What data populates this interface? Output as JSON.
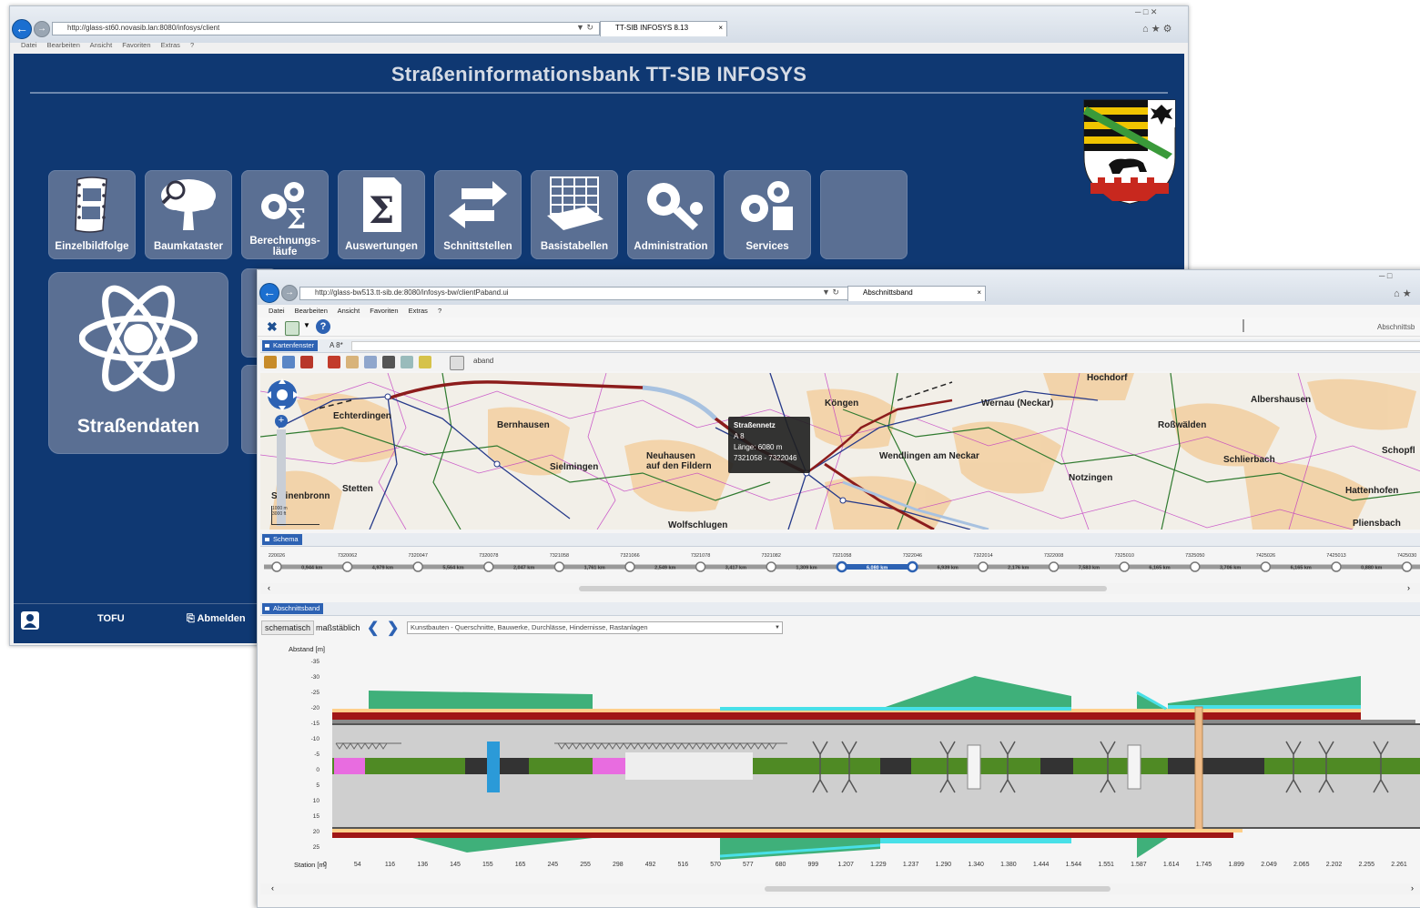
{
  "back_window": {
    "address": "http://glass-st60.novasib.lan:8080/infosys/client",
    "tab_title": "TT-SIB INFOSYS 8.13",
    "menu": [
      "Datei",
      "Bearbeiten",
      "Ansicht",
      "Favoriten",
      "Extras",
      "?"
    ],
    "portal": {
      "title": "Straßeninformationsbank TT-SIB INFOSYS",
      "tiles": [
        {
          "label": "Einzelbildfolge",
          "icon": "film-icon"
        },
        {
          "label": "Baumkataster",
          "icon": "tree-icon"
        },
        {
          "label": "Berechnungs-",
          "label2": "läufe",
          "icon": "gears-sigma-icon"
        },
        {
          "label": "Auswertungen",
          "icon": "sigma-icon"
        },
        {
          "label": "Schnittstellen",
          "icon": "arrows-exchange-icon"
        },
        {
          "label": "Basistabellen",
          "icon": "table-grid-icon"
        },
        {
          "label": "Administration",
          "icon": "gear-wrench-icon"
        },
        {
          "label": "Services",
          "icon": "gears-icon"
        }
      ],
      "big_tile": {
        "label": "Straßendaten",
        "icon": "atom-icon"
      },
      "footer": {
        "center": "TOFU",
        "logout": "Abmelden"
      }
    }
  },
  "front_window": {
    "address": "http://glass-bw513.tt-sib.de:8080/infosys-bw/clientPaband.ui",
    "tab_title": "Abschnittsband",
    "menu": [
      "Datei",
      "Bearbeiten",
      "Ansicht",
      "Favoriten",
      "Extras",
      "?"
    ],
    "right_label": "Abschnittsb",
    "map_panel": {
      "tab": "Kartenfenster",
      "road": "A 8*",
      "toolbar_text": "aband",
      "towns": [
        "Hochdorf",
        "Köngen",
        "Wernau (Neckar)",
        "Albershausen",
        "Echterdingen",
        "Bernhausen",
        "Roßwälden",
        "Schopfl",
        "Wendlingen am Neckar",
        "Neuhausen",
        "auf den Fildern",
        "Sielmingen",
        "Schlierbach",
        "Notzingen",
        "Hattenhofen",
        "Stetten",
        "Steinenbronn",
        "Wolfschlugen",
        "Pliensbach"
      ],
      "tooltip": {
        "line1": "Straßennetz",
        "line2": "A 8",
        "line3": "Länge: 6080 m",
        "line4": "7321058 - 7322046"
      },
      "scale_1": "1000 m",
      "scale_2": "3000 ft"
    },
    "schema_panel": {
      "tab": "Schema",
      "nodes": [
        "220026",
        "7320062",
        "7320047",
        "7320078",
        "7321058",
        "7321066",
        "7321078",
        "7321082",
        "7321058",
        "7322046",
        "7322014",
        "7322008",
        "7325010",
        "7325050",
        "7425026",
        "7425013",
        "7425030"
      ],
      "segments_km": [
        "0,944 km",
        "4,979 km",
        "5,564 km",
        "2,047 km",
        "1,761 km",
        "2,549 km",
        "3,417 km",
        "1,309 km",
        "6,080 km",
        "6,939 km",
        "2,176 km",
        "7,583 km",
        "6,165 km",
        "3,706 km",
        "6,165 km",
        "0,880 km"
      ]
    },
    "band_panel": {
      "tab": "Abschnittsband",
      "btn_schematic": "schematisch",
      "btn_scaled": "maßstäblich",
      "dropdown": "Kunstbauten - Querschnitte, Bauwerke, Durchlässe, Hindernisse, Rastanlagen",
      "y_label": "Abstand [m]",
      "x_label": "Station [m]",
      "y_ticks": [
        "-35",
        "-30",
        "-25",
        "-20",
        "-15",
        "-10",
        "-5",
        "0",
        "5",
        "10",
        "15",
        "20",
        "25"
      ],
      "x_ticks": [
        "0",
        "54",
        "116",
        "136",
        "145",
        "155",
        "165",
        "245",
        "255",
        "298",
        "492",
        "516",
        "570",
        "577",
        "680",
        "999",
        "1.207",
        "1.229",
        "1.237",
        "1.290",
        "1.340",
        "1.380",
        "1.444",
        "1.544",
        "1.551",
        "1.587",
        "1.614",
        "1.745",
        "1.899",
        "2.049",
        "2.065",
        "2.202",
        "2.255",
        "2.261"
      ]
    }
  }
}
